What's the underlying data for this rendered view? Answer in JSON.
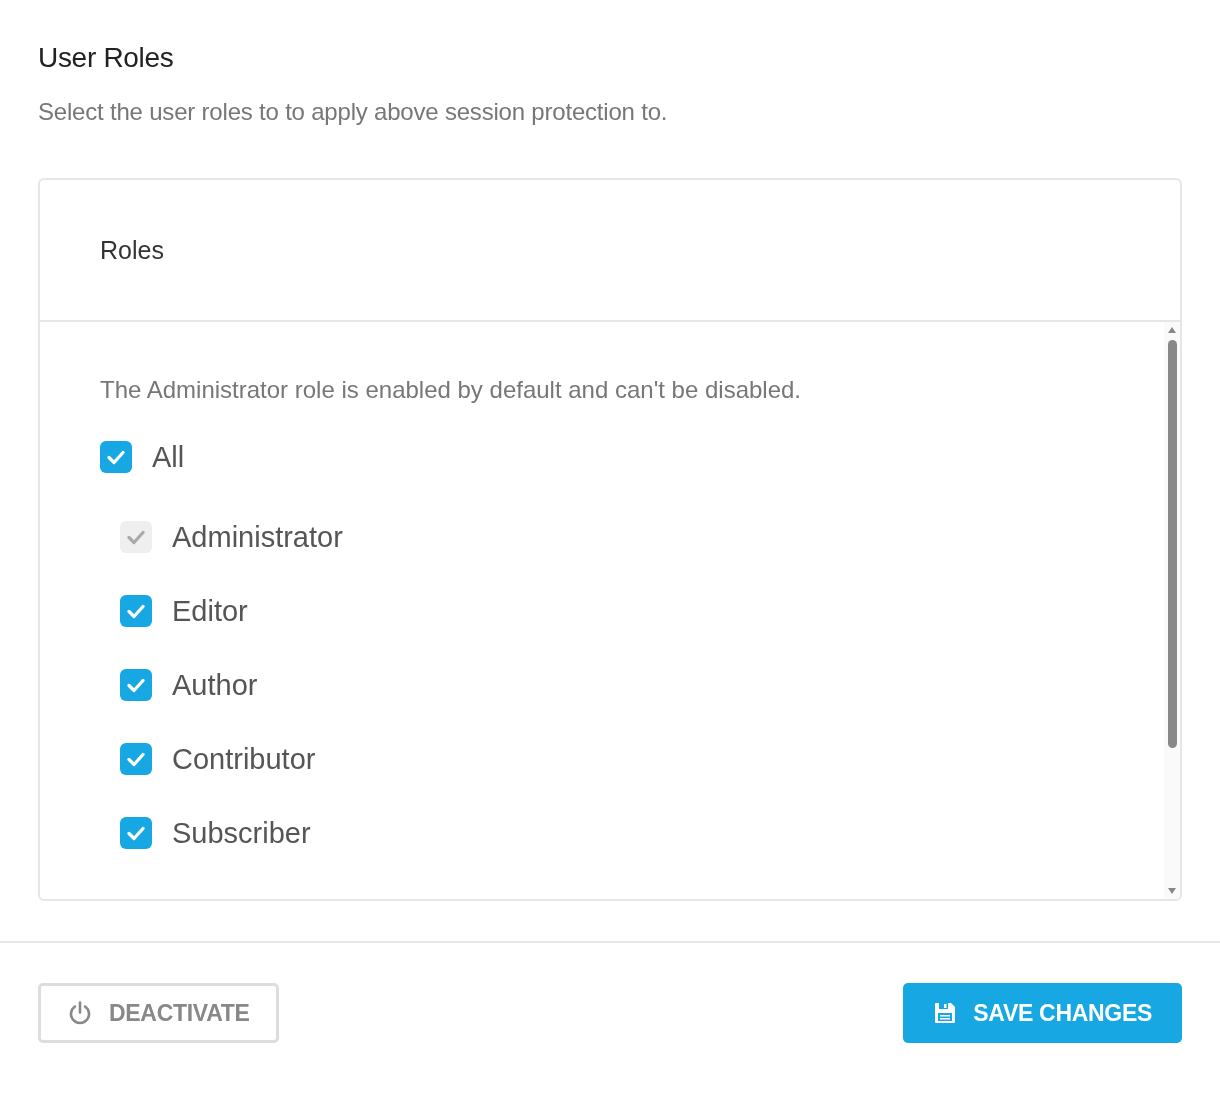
{
  "section": {
    "title": "User Roles",
    "description": "Select the user roles to to apply above session protection to."
  },
  "roles_card": {
    "header": "Roles",
    "note": "The Administrator role is enabled by default and can't be disabled.",
    "all": {
      "label": "All",
      "checked": true
    },
    "roles": [
      {
        "label": "Administrator",
        "checked": true,
        "disabled": true
      },
      {
        "label": "Editor",
        "checked": true,
        "disabled": false
      },
      {
        "label": "Author",
        "checked": true,
        "disabled": false
      },
      {
        "label": "Contributor",
        "checked": true,
        "disabled": false
      },
      {
        "label": "Subscriber",
        "checked": true,
        "disabled": false
      }
    ]
  },
  "footer": {
    "deactivate_button": "DEACTIVATE",
    "save_button": "SAVE CHANGES"
  }
}
